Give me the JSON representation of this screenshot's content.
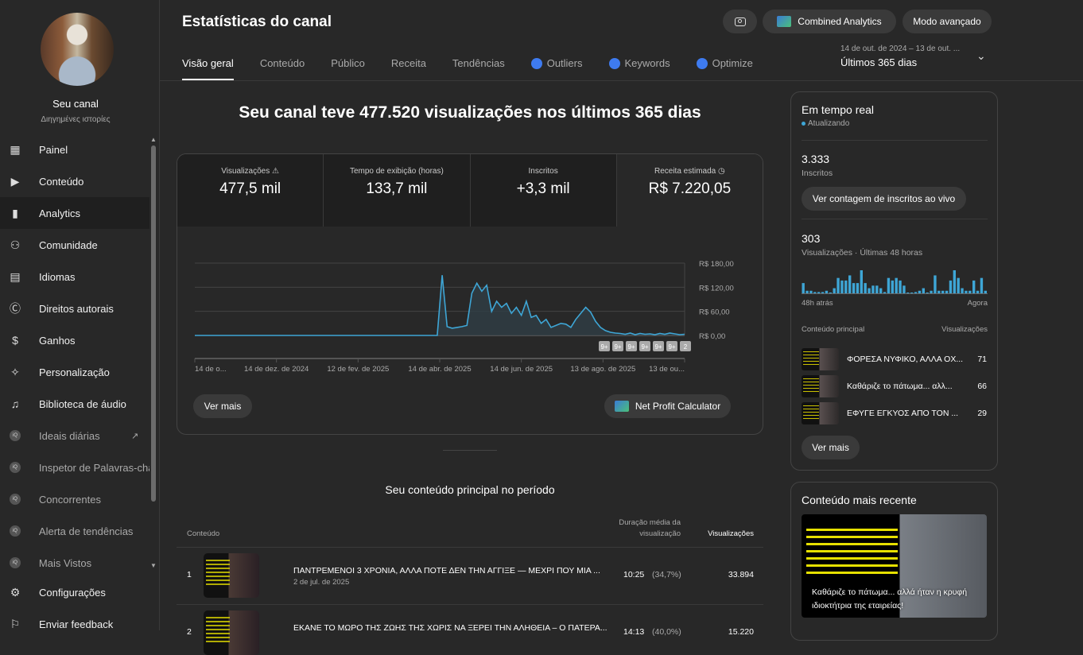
{
  "sidebar": {
    "channel_label": "Seu canal",
    "channel_name": "Διηγημένες ιστορίες",
    "items": [
      {
        "label": "Painel",
        "icon": "dashboard-icon"
      },
      {
        "label": "Conteúdo",
        "icon": "content-icon"
      },
      {
        "label": "Analytics",
        "icon": "analytics-icon"
      },
      {
        "label": "Comunidade",
        "icon": "community-icon"
      },
      {
        "label": "Idiomas",
        "icon": "subtitles-icon"
      },
      {
        "label": "Direitos autorais",
        "icon": "copyright-icon"
      },
      {
        "label": "Ganhos",
        "icon": "dollar-icon"
      },
      {
        "label": "Personalização",
        "icon": "magic-wand-icon"
      },
      {
        "label": "Biblioteca de áudio",
        "icon": "audio-library-icon"
      }
    ],
    "ext_items": [
      {
        "label": "Ideais diárias"
      },
      {
        "label": "Inspetor de Palavras-chave"
      },
      {
        "label": "Concorrentes"
      },
      {
        "label": "Alerta de tendências"
      },
      {
        "label": "Mais Vistos"
      }
    ],
    "bottom": [
      {
        "label": "Configurações"
      },
      {
        "label": "Enviar feedback"
      }
    ]
  },
  "header": {
    "title": "Estatísticas do canal",
    "combined": "Combined Analytics",
    "advanced": "Modo avançado",
    "tabs": [
      "Visão geral",
      "Conteúdo",
      "Público",
      "Receita",
      "Tendências"
    ],
    "ext_tabs": [
      "Outliers",
      "Keywords",
      "Optimize"
    ],
    "date_range": "14 de out. de 2024 – 13 de out. ...",
    "period": "Últimos 365 dias"
  },
  "overview": {
    "headline": "Seu canal teve 477.520 visualizações nos últimos 365 dias",
    "stats": [
      {
        "label": "Visualizações",
        "value": "477,5 mil"
      },
      {
        "label": "Tempo de exibição (horas)",
        "value": "133,7 mil"
      },
      {
        "label": "Inscritos",
        "value": "+3,3 mil"
      },
      {
        "label": "Receita estimada",
        "value": "R$ 7.220,05"
      }
    ],
    "see_more": "Ver mais",
    "net_profit": "Net Profit Calculator",
    "badges": [
      "9+",
      "9+",
      "9+",
      "9+",
      "9+",
      "9+",
      "2"
    ]
  },
  "chart_data": {
    "type": "area",
    "title": "Receita estimada",
    "ylim": [
      0,
      180
    ],
    "yticks": [
      "R$ 0,00",
      "R$ 60,00",
      "R$ 120,00",
      "R$ 180,00"
    ],
    "ytick_values": [
      0,
      60,
      120,
      180
    ],
    "xticks": [
      "14 de o...",
      "14 de dez. de 2024",
      "12 de fev. de 2025",
      "14 de abr. de 2025",
      "14 de jun. de 2025",
      "13 de ago. de 2025",
      "13 de ou..."
    ],
    "values": [
      0,
      0,
      0,
      0,
      0,
      0,
      0,
      0,
      0,
      0,
      0,
      0,
      0,
      0,
      0,
      0,
      0,
      0,
      0,
      0,
      0,
      0,
      0,
      0,
      0,
      0,
      0,
      0,
      0,
      0,
      0,
      0,
      0,
      0,
      0,
      0,
      0,
      0,
      0,
      0,
      0,
      0,
      0,
      0,
      0,
      0,
      0,
      0,
      0,
      0,
      150,
      22,
      18,
      20,
      22,
      25,
      105,
      130,
      110,
      125,
      60,
      85,
      70,
      80,
      55,
      70,
      50,
      85,
      45,
      50,
      30,
      40,
      20,
      25,
      30,
      28,
      20,
      40,
      55,
      70,
      58,
      35,
      20,
      12,
      8,
      6,
      5,
      3,
      6,
      2,
      5,
      3,
      4,
      2,
      5,
      3,
      6,
      4,
      2,
      3
    ]
  },
  "top_content": {
    "title": "Seu conteúdo principal no período",
    "col_content": "Conteúdo",
    "col_duration": "Duração média da visualização",
    "col_views": "Visualizações",
    "rows": [
      {
        "rank": "1",
        "title": "ΠΑΝΤΡΕΜΕΝΟΙ 3 ΧΡΟΝΙΑ, ΑΛΛΑ ΠΟΤΕ ΔΕΝ ΤΗΝ ΑΓΓΙΞΕ — ΜΕΧΡΙ ΠΟΥ ΜΙΑ ...",
        "date": "2 de jul. de 2025",
        "duration": "10:25",
        "pct": "(34,7%)",
        "views": "33.894"
      },
      {
        "rank": "2",
        "title": "ΕΚΑΝΕ ΤΟ ΜΩΡΟ ΤΗΣ ΖΩΗΣ ΤΗΣ ΧΩΡΙΣ ΝΑ ΞΕΡΕΙ ΤΗΝ ΑΛΗΘΕΙΑ – Ο ΠΑΤΕΡΑ...",
        "date": "",
        "duration": "14:13",
        "pct": "(40,0%)",
        "views": "15.220"
      }
    ]
  },
  "realtime": {
    "title": "Em tempo real",
    "status": "Atualizando",
    "subs": "3.333",
    "subs_label": "Inscritos",
    "live_btn": "Ver contagem de inscritos ao vivo",
    "views": "303",
    "views_label": "Visualizações · Últimas 48 horas",
    "start": "48h atrás",
    "end": "Agora",
    "bars": [
      4,
      1,
      1,
      0.5,
      0.5,
      0.5,
      1,
      0,
      2,
      6,
      5,
      5,
      7,
      4,
      4,
      9,
      4,
      2,
      3,
      3,
      2,
      0.5,
      6,
      5,
      6,
      5,
      3,
      0.3,
      0.3,
      0.5,
      1,
      2,
      0,
      1,
      7,
      1,
      1,
      1,
      5,
      9,
      6,
      2,
      1,
      1,
      5,
      1,
      6,
      1
    ],
    "col_content": "Conteúdo principal",
    "col_views": "Visualizações",
    "top": [
      {
        "title": "ΦΟΡΕΣΑ ΝΥΦΙΚΟ, ΑΛΛΑ ΟΧ...",
        "views": "71"
      },
      {
        "title": "Καθάριζε το πάτωμα... αλλ...",
        "views": "66"
      },
      {
        "title": "ΕΦΥΓΕ ΕΓΚΥΟΣ ΑΠΟ ΤΟΝ ...",
        "views": "29"
      }
    ],
    "see_more": "Ver mais"
  },
  "recent": {
    "title": "Conteúdo mais recente",
    "caption": "Καθάριζε το πάτωμα... αλλά ήταν η κρυφή ιδιοκτήτρια της εταιρείας!"
  },
  "colors": {
    "accent": "#3ea6d6",
    "bg": "#282828",
    "dark": "#1f1f1f"
  }
}
